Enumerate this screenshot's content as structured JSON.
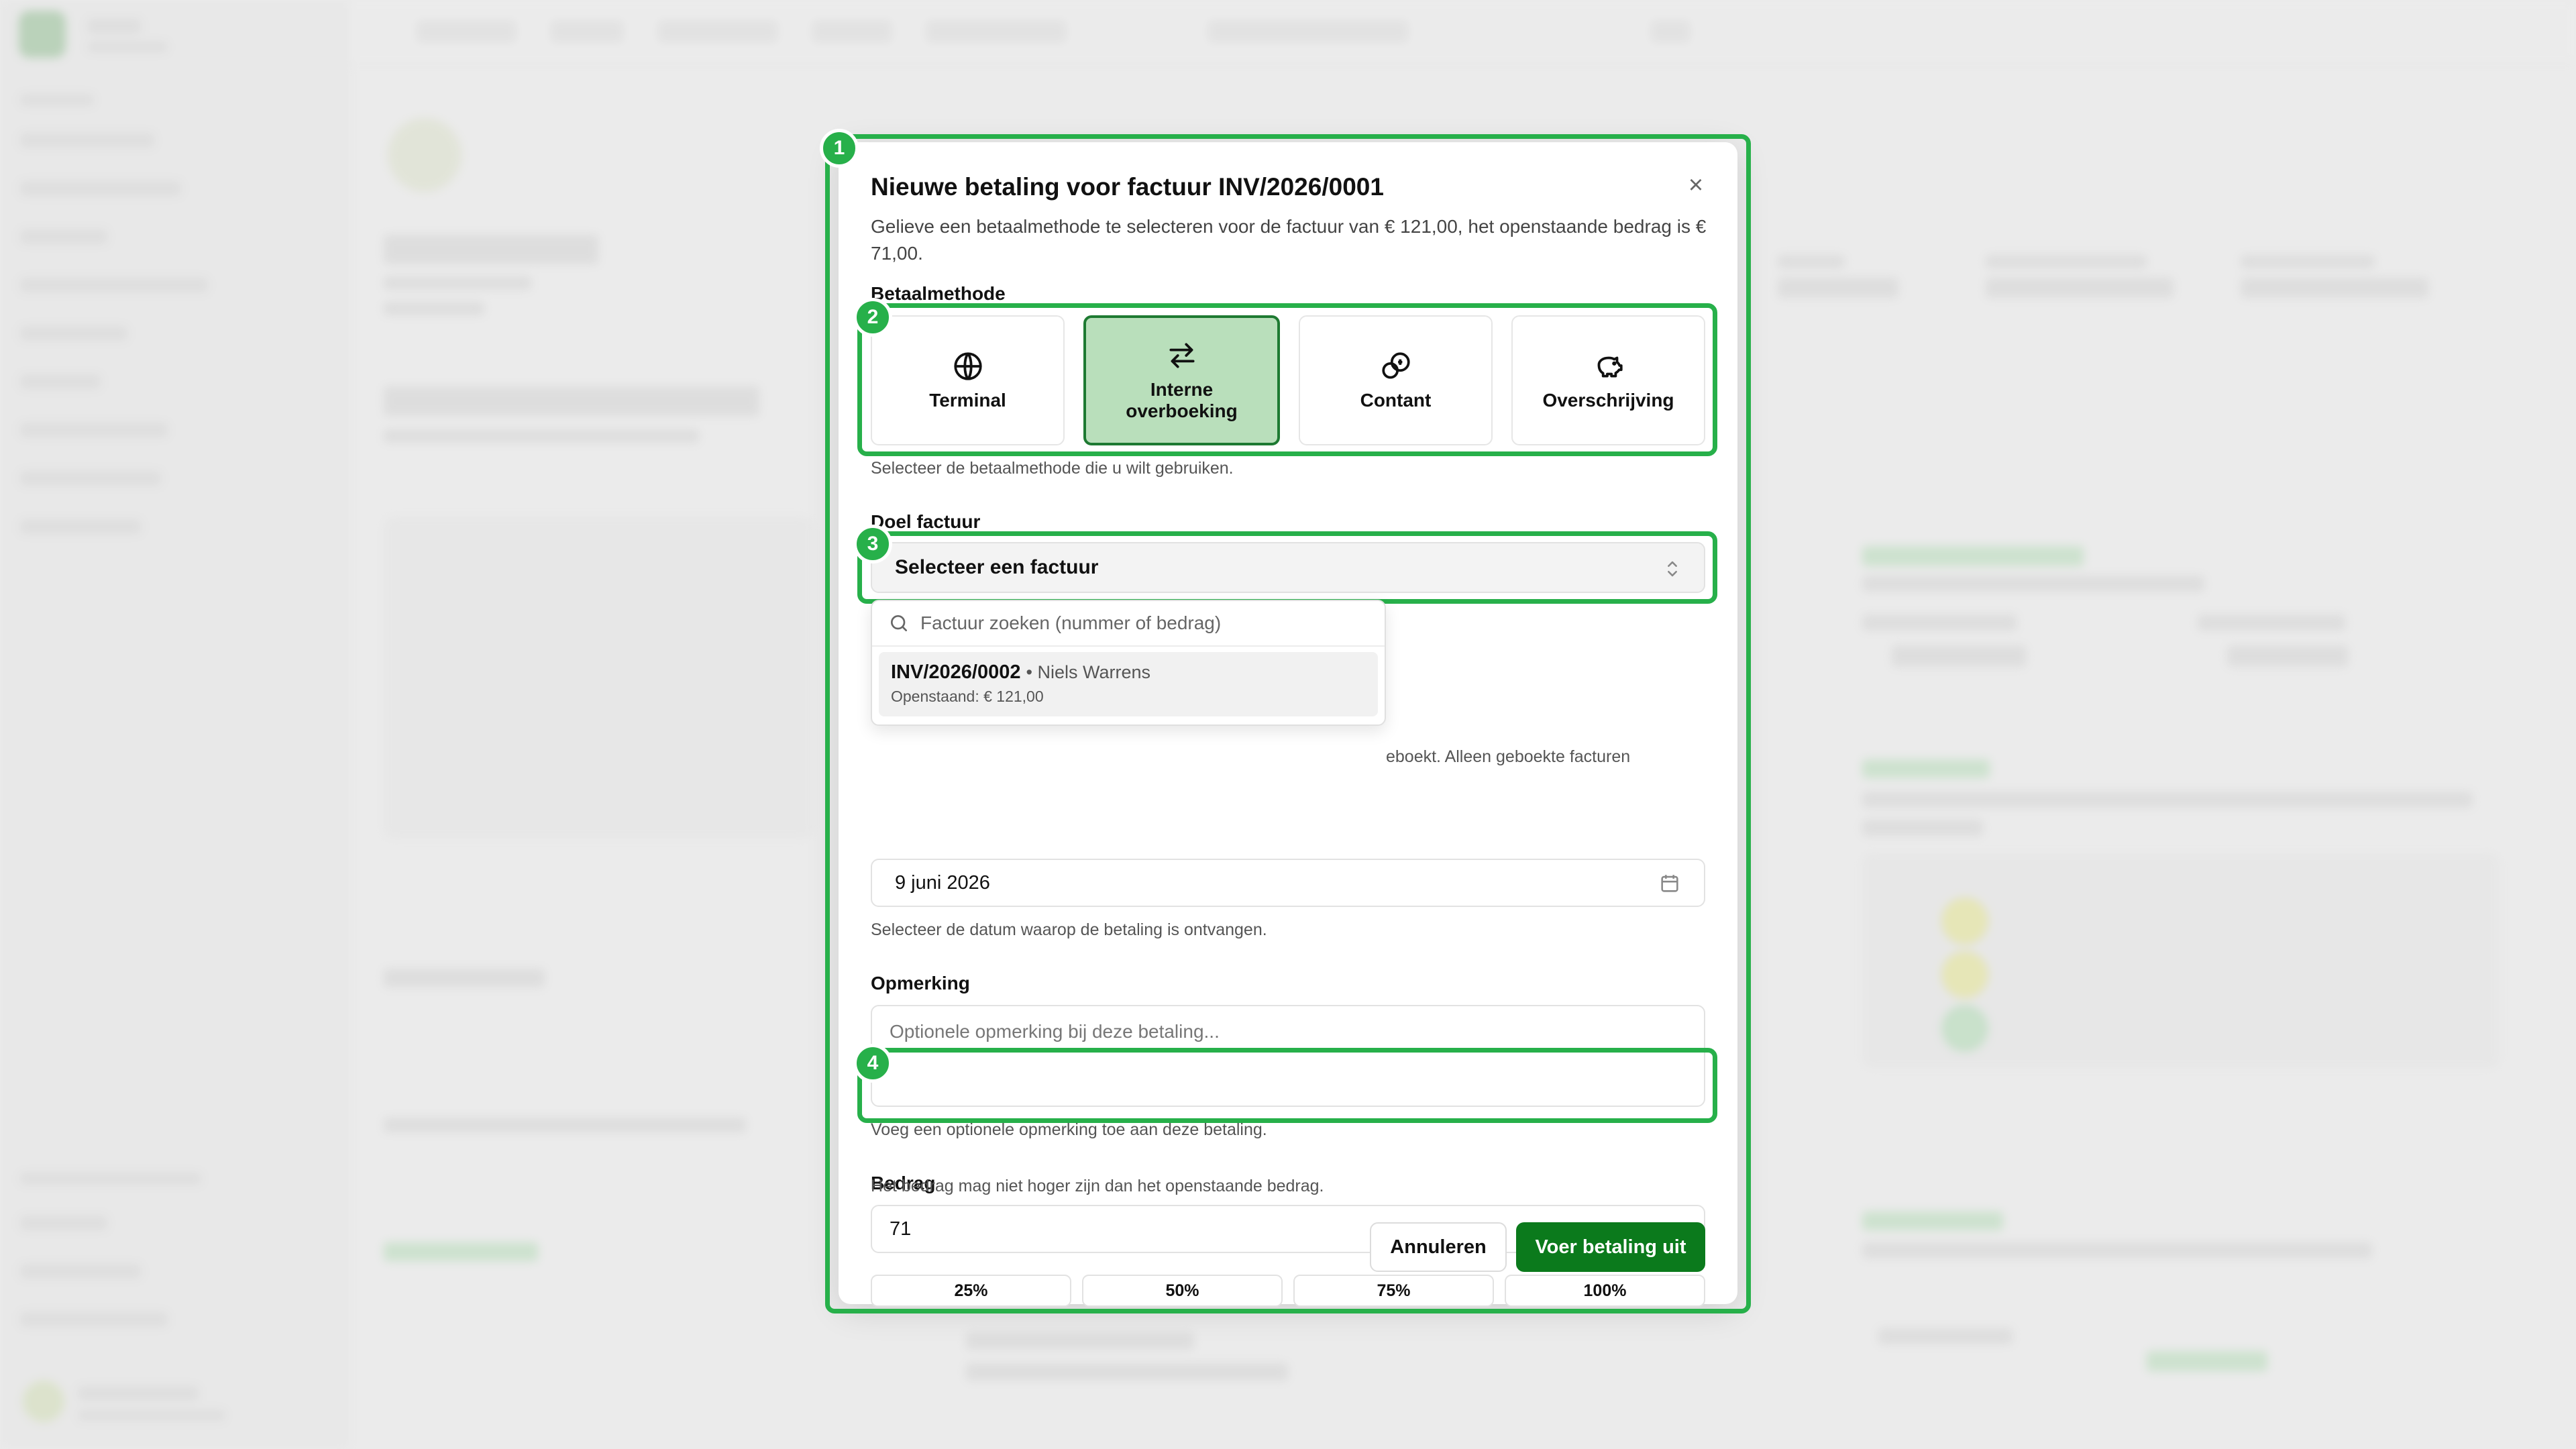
{
  "dialog": {
    "title": "Nieuwe betaling voor factuur INV/2026/0001",
    "close_glyph": "×",
    "description": "Gelieve een betaalmethode te selecteren voor de factuur van € 121,00, het openstaande bedrag is € 71,00."
  },
  "payment_method": {
    "label": "Betaalmethode",
    "hint": "Selecteer de betaalmethode die u wilt gebruiken.",
    "options": [
      {
        "label": "Terminal",
        "icon": "globe-icon",
        "selected": false
      },
      {
        "label": "Interne\noverboeking",
        "icon": "arrows-swap-icon",
        "selected": true
      },
      {
        "label": "Contant",
        "icon": "coins-icon",
        "selected": false
      },
      {
        "label": "Overschrijving",
        "icon": "piggy-bank-icon",
        "selected": false
      }
    ]
  },
  "target_invoice": {
    "label": "Doel factuur",
    "value": "Selecteer een factuur",
    "partial_hint": "eboekt. Alleen geboekte facturen",
    "dropdown": {
      "search_placeholder": "Factuur zoeken (nummer of bedrag)",
      "options": [
        {
          "invoice": "INV/2026/0002",
          "client": "• Niels Warrens",
          "outstanding": "Openstaand: € 121,00"
        }
      ]
    }
  },
  "date": {
    "value": "9 juni 2026",
    "hint": "Selecteer de datum waarop de betaling is ontvangen."
  },
  "remark": {
    "label": "Opmerking",
    "placeholder": "Optionele opmerking bij deze betaling...",
    "hint": "Voeg een optionele opmerking toe aan deze betaling."
  },
  "amount": {
    "label": "Bedrag",
    "value": "71",
    "percent_buttons": [
      "25%",
      "50%",
      "75%",
      "100%"
    ],
    "hint": "Het bedrag mag niet hoger zijn dan het openstaande bedrag."
  },
  "actions": {
    "cancel": "Annuleren",
    "submit": "Voer betaling uit"
  },
  "annotations": [
    "1",
    "2",
    "3",
    "4"
  ],
  "colors": {
    "annotation": "#27b04a",
    "primary": "#0b7a1c",
    "selected_card": "#b9dfbb"
  }
}
